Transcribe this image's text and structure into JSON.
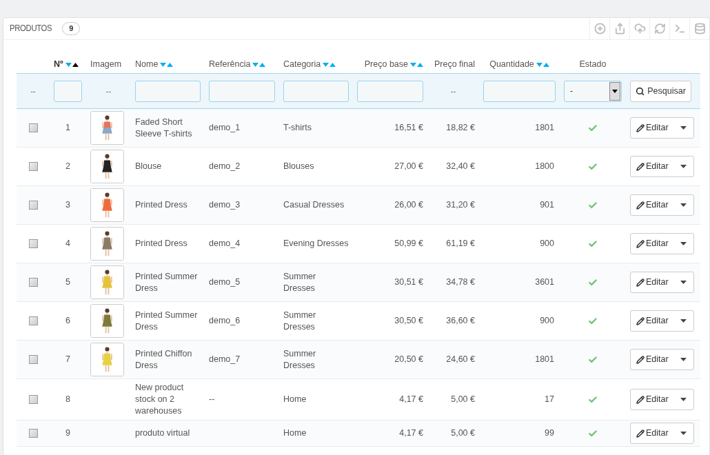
{
  "panel": {
    "title": "PRODUTOS",
    "count": "9"
  },
  "columns": [
    {
      "label": "Nº",
      "sortable": true,
      "sorted": true
    },
    {
      "label": "Imagem",
      "sortable": false,
      "sorted": false
    },
    {
      "label": "Nome",
      "sortable": true,
      "sorted": false
    },
    {
      "label": "Referência",
      "sortable": true,
      "sorted": false
    },
    {
      "label": "Categoria",
      "sortable": true,
      "sorted": false
    },
    {
      "label": "Preço base",
      "sortable": true,
      "sorted": false
    },
    {
      "label": "Preço final",
      "sortable": false,
      "sorted": false
    },
    {
      "label": "Quantidade",
      "sortable": true,
      "sorted": false
    },
    {
      "label": "Estado",
      "sortable": false,
      "sorted": false
    }
  ],
  "filters": [
    {
      "kind": "dash",
      "text": "--"
    },
    {
      "kind": "input"
    },
    {
      "kind": "dash",
      "text": "--"
    },
    {
      "kind": "input"
    },
    {
      "kind": "input"
    },
    {
      "kind": "input"
    },
    {
      "kind": "input"
    },
    {
      "kind": "dash",
      "text": "--"
    },
    {
      "kind": "input"
    },
    {
      "kind": "select",
      "value": "-"
    },
    {
      "kind": "button",
      "label": "Pesquisar"
    }
  ],
  "rows": [
    {
      "checked": false,
      "id": "1",
      "name": "Faded Short Sleeve T-shirts",
      "reference": "demo_1",
      "category": "T-shirts",
      "base_price": "16,51 €",
      "final_price": "18,82 €",
      "quantity": "1801",
      "active": true,
      "action": "Editar"
    },
    {
      "checked": false,
      "id": "2",
      "name": "Blouse",
      "reference": "demo_2",
      "category": "Blouses",
      "base_price": "27,00 €",
      "final_price": "32,40 €",
      "quantity": "1800",
      "active": true,
      "action": "Editar"
    },
    {
      "checked": false,
      "id": "3",
      "name": "Printed Dress",
      "reference": "demo_3",
      "category": "Casual Dresses",
      "base_price": "26,00 €",
      "final_price": "31,20 €",
      "quantity": "901",
      "active": true,
      "action": "Editar"
    },
    {
      "checked": false,
      "id": "4",
      "name": "Printed Dress",
      "reference": "demo_4",
      "category": "Evening Dresses",
      "base_price": "50,99 €",
      "final_price": "61,19 €",
      "quantity": "900",
      "active": true,
      "action": "Editar"
    },
    {
      "checked": false,
      "id": "5",
      "name": "Printed Summer Dress",
      "reference": "demo_5",
      "category": "Summer Dresses",
      "base_price": "30,51 €",
      "final_price": "34,78 €",
      "quantity": "3601",
      "active": true,
      "action": "Editar"
    },
    {
      "checked": false,
      "id": "6",
      "name": "Printed Summer Dress",
      "reference": "demo_6",
      "category": "Summer Dresses",
      "base_price": "30,50 €",
      "final_price": "36,60 €",
      "quantity": "900",
      "active": true,
      "action": "Editar"
    },
    {
      "checked": false,
      "id": "7",
      "name": "Printed Chiffon Dress",
      "reference": "demo_7",
      "category": "Summer Dresses",
      "base_price": "20,50 €",
      "final_price": "24,60 €",
      "quantity": "1801",
      "active": true,
      "action": "Editar"
    },
    {
      "checked": false,
      "id": "8",
      "name": "New product stock on 2 warehouses",
      "reference": "--",
      "category": "Home",
      "base_price": "4,17 €",
      "final_price": "5,00 €",
      "quantity": "17",
      "active": true,
      "action": "Editar"
    },
    {
      "checked": false,
      "id": "9",
      "name": "produto virtual",
      "category": "Home",
      "base_price": "4,17 €",
      "final_price": "5,00 €",
      "quantity": "99",
      "active": true,
      "action": "Editar"
    }
  ]
}
